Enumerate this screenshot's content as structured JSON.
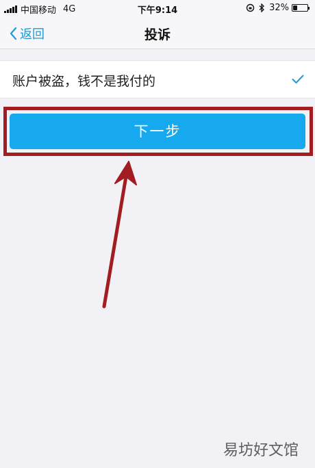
{
  "status_bar": {
    "carrier": "中国移动",
    "network": "4G",
    "time": "下午9:14",
    "battery_percent": "32%",
    "battery_level": 0.32
  },
  "nav": {
    "back_label": "返回",
    "title": "投诉"
  },
  "option": {
    "label": "账户被盗，钱不是我付的",
    "selected": true
  },
  "next_button": {
    "label": "下一步"
  },
  "annotation": {
    "highlight_color": "#a11d22",
    "arrow_color": "#a11d22"
  },
  "watermark": "易坊好文馆",
  "colors": {
    "accent": "#16a9ee",
    "link": "#1e9ad6",
    "background": "#f2f1f6"
  }
}
